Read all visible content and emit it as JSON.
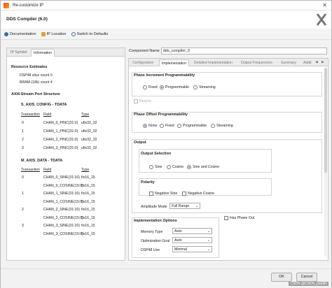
{
  "window": {
    "title": "Re-customize IP"
  },
  "header": {
    "title": "DDS Compiler (6.0)"
  },
  "toolbar": {
    "documentation": "Documentation",
    "ip_location": "IP Location",
    "switch_defaults": "Switch to Defaults"
  },
  "left": {
    "tabs": [
      "IP Symbol",
      "Information"
    ],
    "resource_title": "Resource Estimates",
    "resources": [
      "DSP48 slice count 0",
      "BRAM (18k) count 4"
    ],
    "axi_title": "AXI4-Stream Port Structure",
    "config_title": "S_AXIS_CONFIG - TDATA",
    "config_headers": [
      "Transaction",
      "Field",
      "Type"
    ],
    "config_rows": [
      [
        "0",
        "CHAN_0_PINC(31:0)",
        "ufix32_32"
      ],
      [
        "1",
        "CHAN_1_PINC(31:0)",
        "ufix32_32"
      ],
      [
        "2",
        "CHAN_2_PINC(31:0)",
        "ufix32_32"
      ],
      [
        "3",
        "CHAN_3_PINC(31:0)",
        "ufix32_32"
      ]
    ],
    "data_title": "M_AXIS_DATA - TDATA",
    "data_headers": [
      "Transaction",
      "Field",
      "Type"
    ],
    "data_rows": [
      [
        "0",
        "CHAN_0_SINE(31:16)",
        "fix16_15"
      ],
      [
        "",
        "CHAN_0_COSINE(15:0)",
        "fix16_15"
      ],
      [
        "1",
        "CHAN_1_SINE(31:16)",
        "fix16_15"
      ],
      [
        "",
        "CHAN_1_COSINE(15:0)",
        "fix16_15"
      ],
      [
        "2",
        "CHAN_2_SINE(31:16)",
        "fix16_15"
      ],
      [
        "",
        "CHAN_2_COSINE(15:0)",
        "fix16_15"
      ],
      [
        "3",
        "CHAN_3_SINE(31:16)",
        "fix16_15"
      ],
      [
        "",
        "CHAN_3_COSINE(15:0)",
        "fix16_15"
      ]
    ]
  },
  "right": {
    "component_label": "Component Name",
    "component_value": "dds_compiler_0",
    "tabs": [
      "Configuration",
      "Implementation",
      "Detailed Implementation",
      "Output Frequencies",
      "Summary",
      "Addit"
    ],
    "phase_inc_title": "Phase Increment Programmability",
    "phase_inc_options": [
      "Fixed",
      "Programmable",
      "Streaming"
    ],
    "resync": "Resync",
    "phase_off_title": "Phase Offset Programmability",
    "phase_off_options": [
      "None",
      "Fixed",
      "Programmable",
      "Streaming"
    ],
    "output_title": "Output",
    "output_sel_title": "Output Selection",
    "output_sel_options": [
      "Sine",
      "Cosine",
      "Sine and Cosine"
    ],
    "polarity_title": "Polarity",
    "negative_sine": "Negative Sine",
    "negative_cosine": "Negative Cosine",
    "amplitude_label": "Amplitude Mode",
    "amplitude_value": "Full Range",
    "impl_title": "Implementation Options",
    "has_phase_out": "Has Phase Out",
    "memory_label": "Memory Type",
    "memory_value": "Auto",
    "opt_label": "Optimization Goal",
    "opt_value": "Auto",
    "dsp_label": "DSP48 Use",
    "dsp_value": "Minimal"
  },
  "buttons": {
    "ok": "OK",
    "cancel": "Cancel"
  },
  "watermark": "CSDN @CSDN_paddle"
}
